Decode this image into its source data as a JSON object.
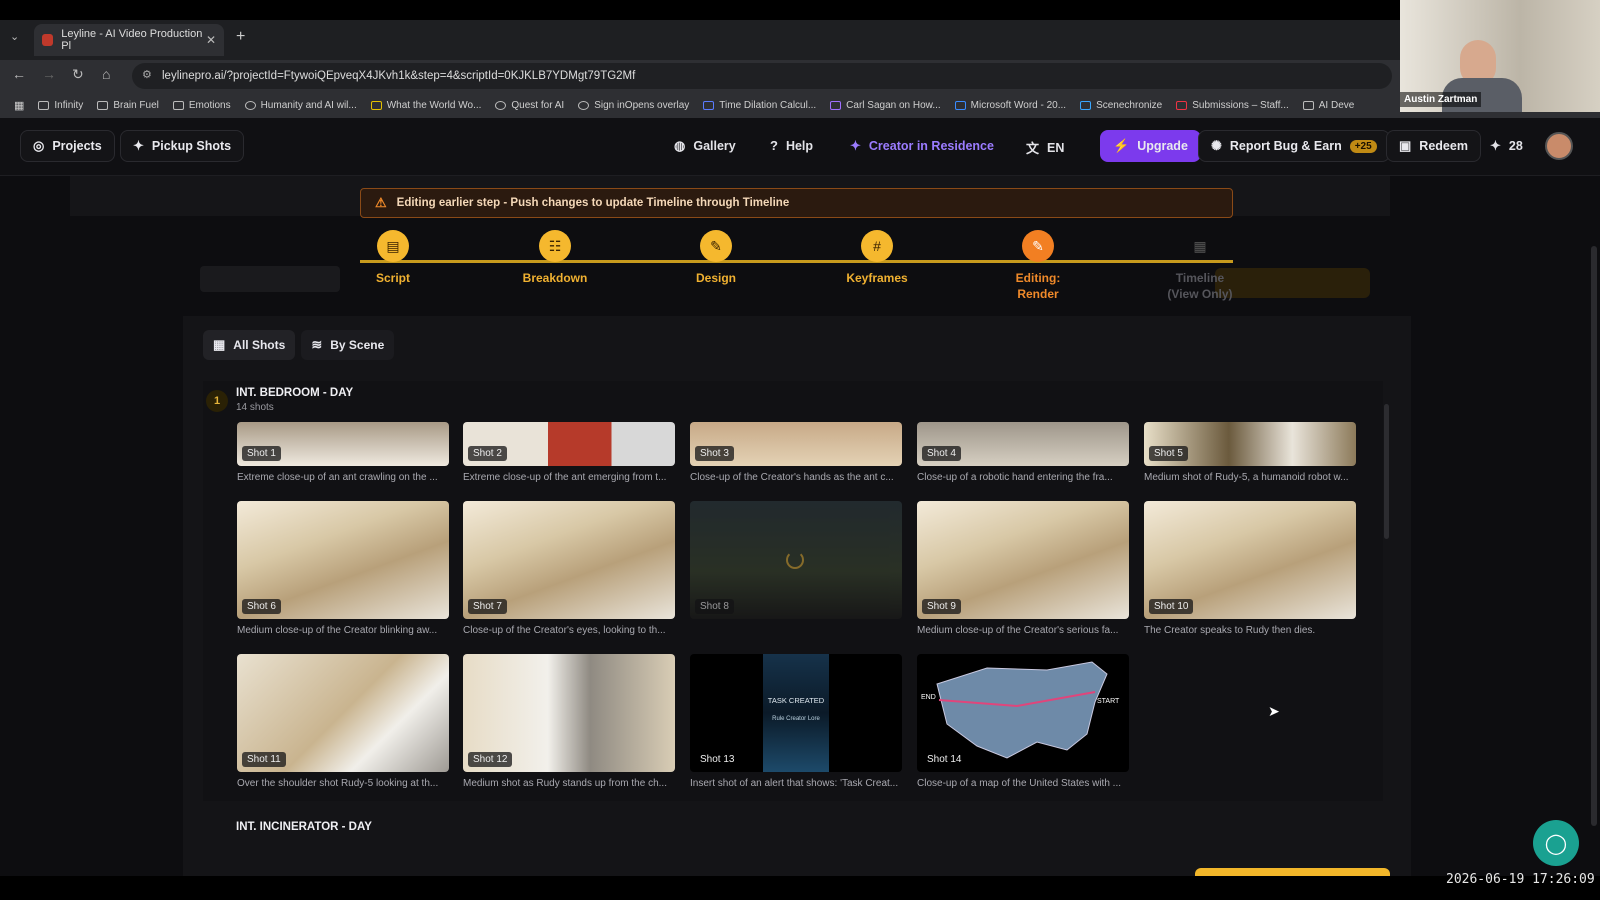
{
  "browser": {
    "tab_title": "Leyline - AI Video Production Pl",
    "url": "leylinepro.ai/?projectId=FtywoiQEpveqX4JKvh1k&step=4&scriptId=0KJKLB7YDMgt79TG2Mf",
    "bookmarks": [
      "Infinity",
      "Brain Fuel",
      "Emotions",
      "Humanity and AI wil...",
      "What the World Wo...",
      "Quest for AI",
      "Sign inOpens overlay",
      "Time Dilation Calcul...",
      "Carl Sagan on How...",
      "Microsoft Word - 20...",
      "Scenechronize",
      "Submissions – Staff...",
      "AI Deve"
    ]
  },
  "webcam": {
    "name": "Austin Zartman"
  },
  "header": {
    "projects": "Projects",
    "pickup": "Pickup Shots",
    "gallery": "Gallery",
    "help": "Help",
    "creator": "Creator in Residence",
    "lang": "EN",
    "upgrade": "Upgrade",
    "report": "Report Bug & Earn",
    "report_badge": "+25",
    "redeem": "Redeem",
    "credits": "28"
  },
  "banner": "Editing earlier step - Push changes to update Timeline through Timeline",
  "steps": [
    {
      "label": "Script"
    },
    {
      "label": "Breakdown"
    },
    {
      "label": "Design"
    },
    {
      "label": "Keyframes"
    },
    {
      "label": "Editing: Render"
    },
    {
      "label": "Timeline (View Only)"
    }
  ],
  "view_tabs": {
    "all": "All Shots",
    "by_scene": "By Scene"
  },
  "scene1": {
    "number": "1",
    "title": "INT. BEDROOM - DAY",
    "count": "14 shots",
    "shots": [
      {
        "label": "Shot 1",
        "desc": "Extreme close-up of an ant crawling on the ..."
      },
      {
        "label": "Shot 2",
        "desc": "Extreme close-up of the ant emerging from t..."
      },
      {
        "label": "Shot 3",
        "desc": "Close-up of the Creator's hands as the ant c..."
      },
      {
        "label": "Shot 4",
        "desc": "Close-up of a robotic hand entering the fra..."
      },
      {
        "label": "Shot 5",
        "desc": "Medium shot of Rudy-5, a humanoid robot w..."
      },
      {
        "label": "Shot 6",
        "desc": "Medium close-up of the Creator blinking aw..."
      },
      {
        "label": "Shot 7",
        "desc": "Close-up of the Creator's eyes, looking to th..."
      },
      {
        "label": "Shot 8",
        "desc": ""
      },
      {
        "label": "Shot 9",
        "desc": "Medium close-up of the Creator's serious fa..."
      },
      {
        "label": "Shot 10",
        "desc": "The Creator speaks to Rudy then dies."
      },
      {
        "label": "Shot 11",
        "desc": "Over the shoulder shot Rudy-5 looking at th..."
      },
      {
        "label": "Shot 12",
        "desc": "Medium shot as Rudy stands up from the ch..."
      },
      {
        "label": "Shot 13",
        "desc": "Insert shot of an alert that shows: 'Task Creat..."
      },
      {
        "label": "Shot 14",
        "desc": "Close-up of a map of the United States with ..."
      }
    ],
    "shot13_text1": "TASK CREATED",
    "shot13_text2": "Rule Creator Lore",
    "shot14_end": "END",
    "shot14_start": "START"
  },
  "scene2": {
    "title": "INT. INCINERATOR - DAY"
  },
  "timestamp": "2026-06-19 17:26:09",
  "colors": {
    "accent": "#f5b82e",
    "active": "#f27f22",
    "upgrade": "#7c3aed",
    "chat": "#1aa191"
  }
}
